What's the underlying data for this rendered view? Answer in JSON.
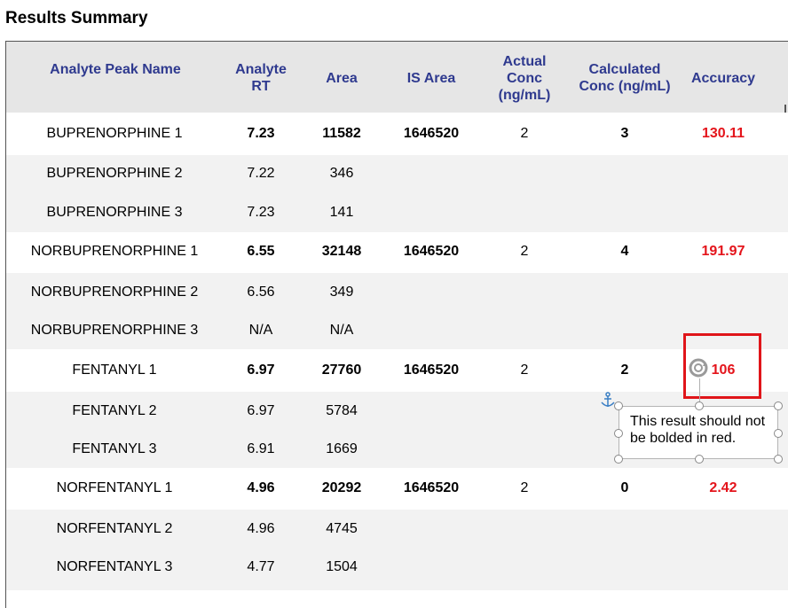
{
  "title": "Results Summary",
  "columns": [
    {
      "label": "Analyte Peak Name"
    },
    {
      "label": "Analyte RT"
    },
    {
      "label": "Area"
    },
    {
      "label": "IS Area"
    },
    {
      "label": "Actual Conc (ng/mL)"
    },
    {
      "label": "Calculated Conc (ng/mL)"
    },
    {
      "label": "Accuracy"
    }
  ],
  "rows": [
    {
      "name": "BUPRENORPHINE 1",
      "rt": "7.23",
      "area": "11582",
      "is_area": "1646520",
      "actual": "2",
      "calc": "3",
      "accuracy": "130.11"
    },
    {
      "name": "BUPRENORPHINE 2",
      "rt": "7.22",
      "area": "346",
      "is_area": "",
      "actual": "",
      "calc": "",
      "accuracy": ""
    },
    {
      "name": "BUPRENORPHINE 3",
      "rt": "7.23",
      "area": "141",
      "is_area": "",
      "actual": "",
      "calc": "",
      "accuracy": ""
    },
    {
      "name": "NORBUPRENORPHINE 1",
      "rt": "6.55",
      "area": "32148",
      "is_area": "1646520",
      "actual": "2",
      "calc": "4",
      "accuracy": "191.97"
    },
    {
      "name": "NORBUPRENORPHINE 2",
      "rt": "6.56",
      "area": "349",
      "is_area": "",
      "actual": "",
      "calc": "",
      "accuracy": ""
    },
    {
      "name": "NORBUPRENORPHINE 3",
      "rt": "N/A",
      "area": "N/A",
      "is_area": "",
      "actual": "",
      "calc": "",
      "accuracy": ""
    },
    {
      "name": "FENTANYL 1",
      "rt": "6.97",
      "area": "27760",
      "is_area": "1646520",
      "actual": "2",
      "calc": "2",
      "accuracy": "106"
    },
    {
      "name": "FENTANYL 2",
      "rt": "6.97",
      "area": "5784",
      "is_area": "",
      "actual": "",
      "calc": "",
      "accuracy": ""
    },
    {
      "name": "FENTANYL 3",
      "rt": "6.91",
      "area": "1669",
      "is_area": "",
      "actual": "",
      "calc": "",
      "accuracy": ""
    },
    {
      "name": "NORFENTANYL 1",
      "rt": "4.96",
      "area": "20292",
      "is_area": "1646520",
      "actual": "2",
      "calc": "0",
      "accuracy": "2.42"
    },
    {
      "name": "NORFENTANYL 2",
      "rt": "4.96",
      "area": "4745",
      "is_area": "",
      "actual": "",
      "calc": "",
      "accuracy": ""
    },
    {
      "name": "NORFENTANYL 3",
      "rt": "4.77",
      "area": "1504",
      "is_area": "",
      "actual": "",
      "calc": "",
      "accuracy": ""
    }
  ],
  "annotation": {
    "text": "This result should not be bolded in red."
  },
  "colors": {
    "header_text": "#2f3a8f",
    "header_bg": "#e6e6e6",
    "stripe_bg": "#f2f2f2",
    "accuracy_red": "#e4141b",
    "highlight_box": "#e0151a"
  },
  "icons": [
    "anchor-icon",
    "rotate-handle-icon"
  ]
}
